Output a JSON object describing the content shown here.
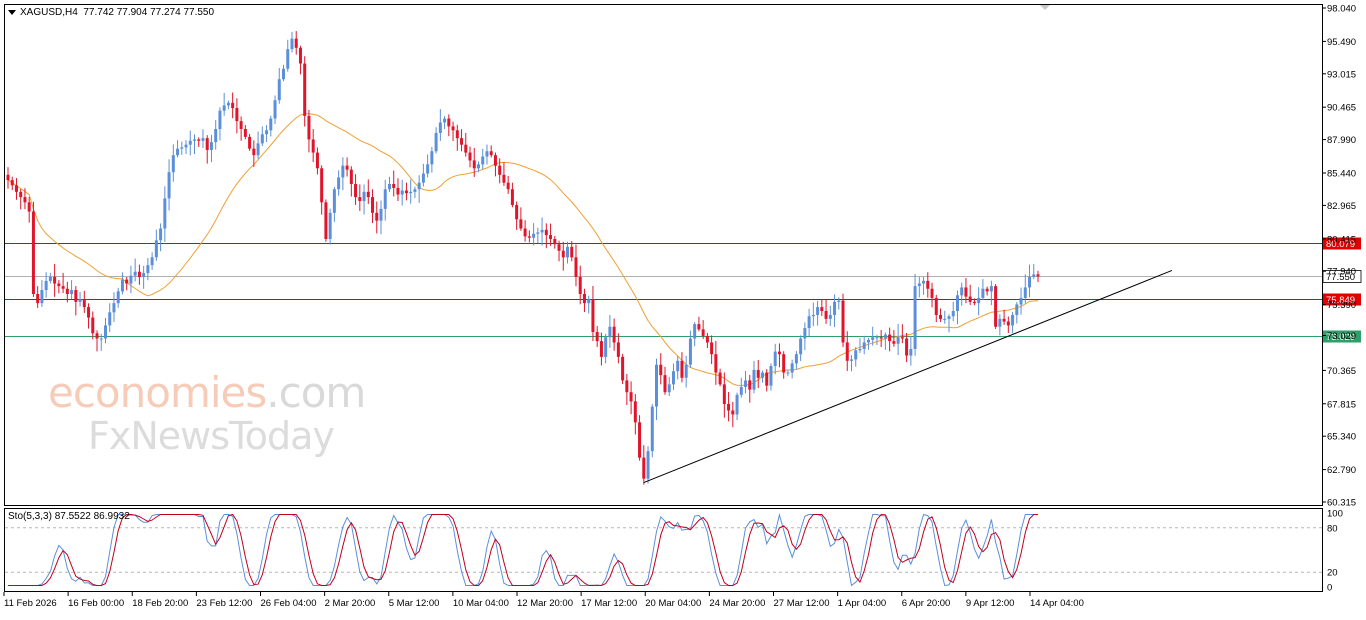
{
  "header": {
    "symbol": "XAGUSD,H4",
    "ohlc": "77.742 77.904 77.274 77.550"
  },
  "stochastic": {
    "label": "Sto(5,3,3) 87.5522 86.9932",
    "levels": [
      "100",
      "80",
      "20",
      "0"
    ]
  },
  "watermark": {
    "line1_main": "economies",
    "line1_dim": ".com",
    "line2": "FxNewsToday"
  },
  "colors": {
    "bull": "#5b8fd9",
    "bear": "#e0142a",
    "ma": "#f0a030",
    "resistance": "#e00000",
    "support": "#2e9e6a",
    "current": "#b0b0b0",
    "trendline": "#000000",
    "stoch_main": "#5b8fd9",
    "stoch_signal": "#c00020"
  },
  "chart_data": {
    "type": "candlestick",
    "title": "XAGUSD,H4",
    "price_axis_ticks": [
      "98.040",
      "95.490",
      "93.015",
      "90.465",
      "87.990",
      "85.440",
      "82.965",
      "80.415",
      "77.940",
      "75.390",
      "73.029",
      "70.365",
      "67.815",
      "65.340",
      "62.790",
      "60.315"
    ],
    "ylim": [
      60.315,
      98.04
    ],
    "time_axis_labels": [
      "11 Feb 2026",
      "16 Feb 00:00",
      "18 Feb 20:00",
      "23 Feb 12:00",
      "26 Feb 04:00",
      "2 Mar 20:00",
      "5 Mar 12:00",
      "10 Mar 04:00",
      "12 Mar 20:00",
      "17 Mar 12:00",
      "20 Mar 04:00",
      "24 Mar 20:00",
      "27 Mar 12:00",
      "1 Apr 04:00",
      "6 Apr 20:00",
      "9 Apr 12:00",
      "14 Apr 04:00"
    ],
    "horizontal_levels": [
      {
        "name": "resistance",
        "value": 80.079,
        "label": "80.079"
      },
      {
        "name": "support",
        "value": 75.849,
        "label": "75.849"
      },
      {
        "name": "lower-support",
        "value": 73.029,
        "label": "73.029"
      },
      {
        "name": "current-price",
        "value": 77.55,
        "label": "77.550"
      }
    ],
    "trendline": {
      "from": {
        "time": "20 Mar 04:00",
        "price": 61.8
      },
      "to_price_projected": 78.0
    },
    "closes": [
      84.9,
      84.5,
      84.0,
      83.6,
      83.2,
      82.5,
      76.2,
      75.5,
      76.5,
      77.2,
      77.5,
      77.0,
      76.8,
      76.6,
      76.2,
      76.5,
      75.6,
      75.8,
      75.2,
      74.4,
      73.2,
      72.8,
      72.8,
      73.8,
      74.8,
      75.5,
      76.4,
      77.3,
      77.0,
      77.6,
      77.9,
      77.5,
      77.8,
      78.4,
      79.0,
      80.3,
      81.2,
      83.5,
      85.5,
      86.8,
      87.3,
      87.4,
      87.6,
      87.9,
      88.0,
      87.9,
      88.1,
      87.2,
      87.8,
      88.8,
      90.2,
      90.6,
      90.8,
      90.4,
      89.4,
      88.8,
      88.2,
      87.3,
      86.8,
      87.7,
      88.4,
      88.7,
      89.6,
      91.0,
      92.6,
      93.4,
      94.9,
      95.7,
      95.0,
      93.8,
      89.8,
      88.0,
      87.0,
      85.8,
      83.2,
      80.4,
      82.4,
      84.2,
      85.1,
      86.0,
      85.7,
      84.6,
      83.6,
      83.3,
      84.0,
      83.6,
      82.4,
      81.8,
      82.7,
      84.2,
      84.6,
      84.3,
      83.8,
      84.1,
      83.9,
      84.0,
      84.2,
      84.7,
      85.4,
      86.1,
      87.1,
      88.5,
      89.3,
      89.6,
      89.0,
      88.7,
      88.1,
      87.6,
      87.0,
      86.4,
      85.8,
      86.1,
      86.7,
      87.1,
      86.8,
      86.0,
      85.3,
      84.7,
      84.2,
      83.0,
      81.9,
      81.2,
      80.6,
      80.5,
      80.8,
      80.9,
      81.1,
      80.7,
      80.4,
      80.0,
      79.5,
      79.0,
      79.8,
      79.0,
      77.5,
      76.2,
      75.5,
      75.8,
      73.3,
      72.6,
      71.4,
      72.9,
      73.7,
      72.5,
      71.4,
      69.6,
      68.7,
      68.0,
      66.4,
      63.7,
      62.1,
      64.2,
      67.6,
      70.8,
      70.0,
      68.7,
      69.3,
      70.3,
      71.1,
      69.8,
      70.8,
      72.8,
      73.9,
      73.5,
      73.0,
      72.5,
      71.6,
      70.2,
      69.3,
      67.8,
      67.3,
      67.0,
      68.5,
      69.1,
      69.6,
      68.9,
      70.4,
      69.8,
      70.2,
      69.2,
      70.7,
      71.8,
      71.6,
      70.2,
      70.2,
      70.9,
      71.6,
      72.8,
      73.6,
      74.5,
      74.6,
      75.2,
      74.9,
      74.3,
      74.6,
      75.6,
      75.7,
      72.5,
      71.1,
      71.2,
      71.9,
      72.0,
      72.5,
      72.7,
      72.9,
      72.9,
      72.8,
      73.1,
      72.6,
      72.4,
      72.9,
      72.8,
      71.5,
      72.0,
      76.8,
      77.0,
      77.2,
      76.6,
      75.9,
      74.6,
      74.3,
      74.3,
      74.5,
      74.9,
      76.1,
      76.7,
      76.0,
      75.6,
      75.5,
      75.9,
      76.6,
      76.4,
      76.8,
      73.7,
      74.3,
      74.1,
      73.8,
      74.6,
      75.4,
      75.9,
      76.7,
      77.5,
      77.7,
      77.55
    ]
  }
}
